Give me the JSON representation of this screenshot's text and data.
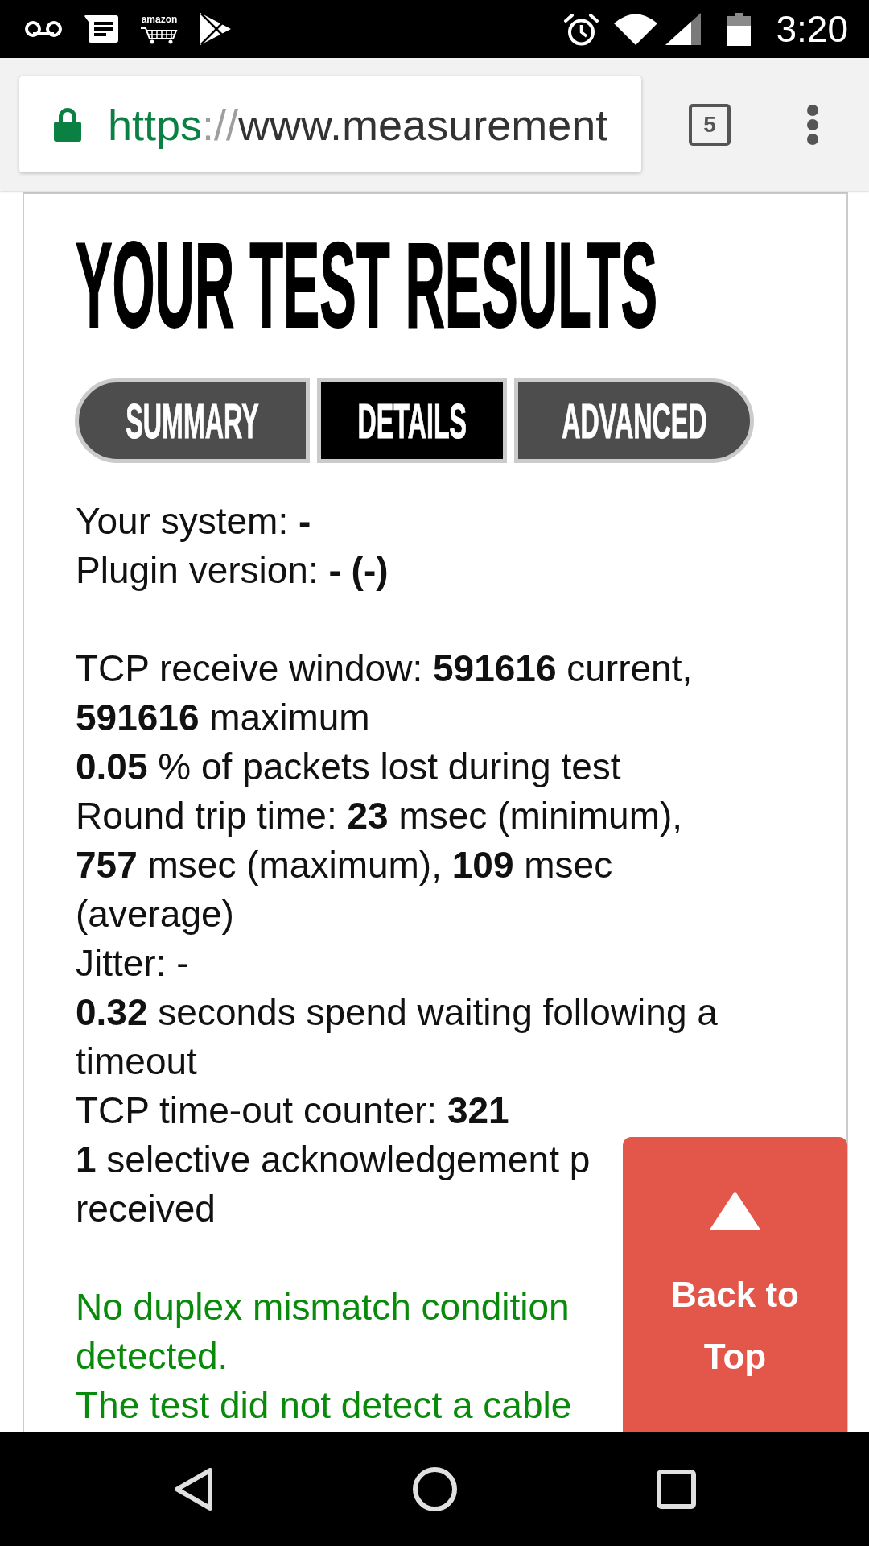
{
  "status_bar": {
    "notification_logo_text": "amazon",
    "time": "3:20"
  },
  "browser_toolbar": {
    "url": {
      "secure": true,
      "scheme": "https",
      "separator": "://",
      "rest": "www.measurement"
    },
    "tab_count": "5"
  },
  "page": {
    "title": "YOUR TEST RESULTS",
    "tabs": [
      {
        "label": "SUMMARY",
        "selected": false
      },
      {
        "label": "DETAILS",
        "selected": true
      },
      {
        "label": "ADVANCED",
        "selected": false
      }
    ],
    "system_info": [
      "Your system: **-**",
      "Plugin version: **- (-)**"
    ],
    "statistics": [
      "TCP receive window: **591616** current, **591616** maximum",
      "**0.05** % of packets lost during test",
      "Round trip time: **23** msec (minimum), **757** msec (maximum), **109** msec (average)",
      "Jitter: -",
      "**0.32** seconds spend waiting following a timeout",
      "TCP time-out counter: **321**",
      "**1** selective acknowledgement p\nreceived"
    ],
    "diagnostics": [
      "No duplex mismatch condition\ndetected.",
      "The test did not detect a cable"
    ],
    "back_to_top": "Back to Top"
  }
}
